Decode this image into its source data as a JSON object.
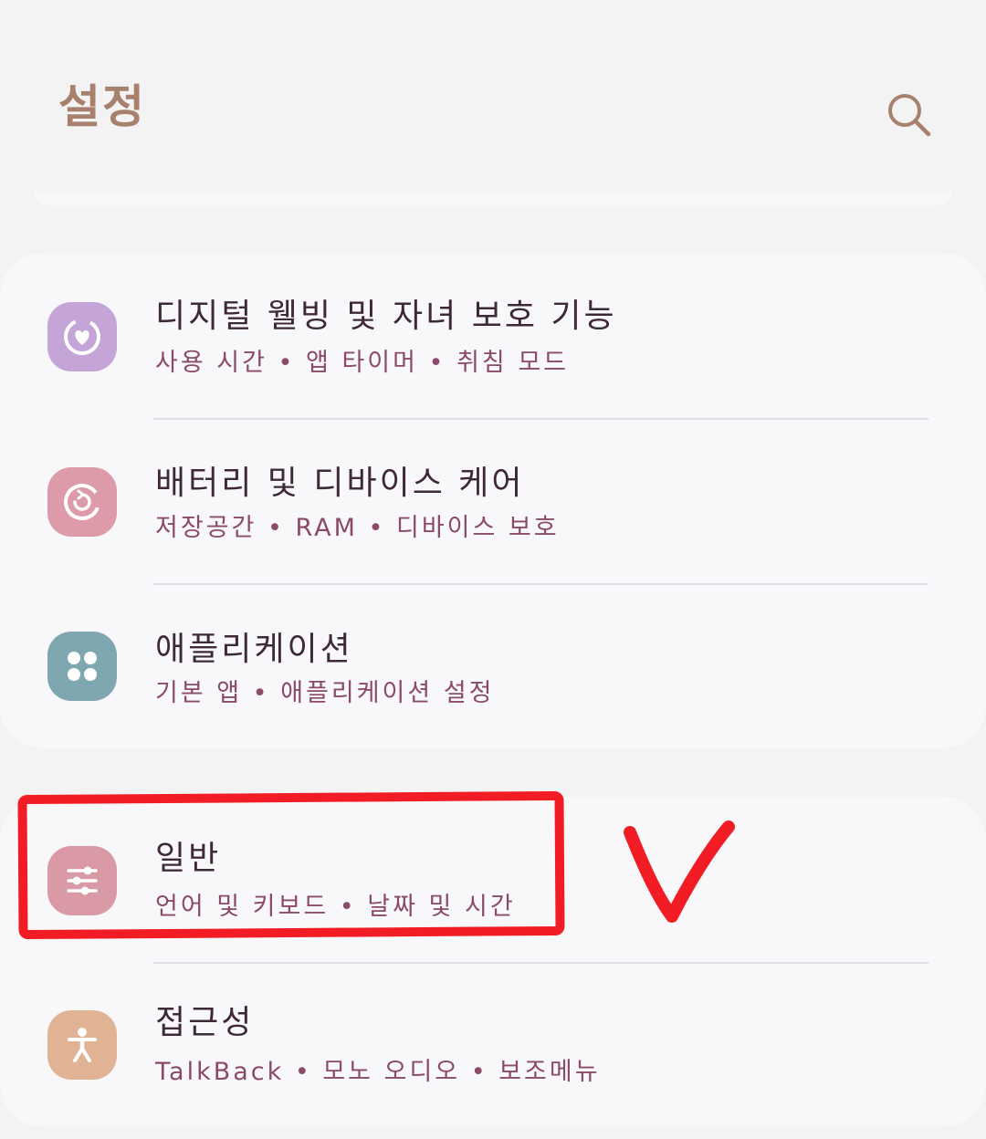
{
  "header": {
    "title": "설정",
    "search_icon": "search-icon"
  },
  "settings": {
    "items": [
      {
        "title": "디지털 웰빙 및 자녀 보호 기능",
        "subtitle": "사용 시간 • 앱 타이머 • 취침 모드",
        "icon": "digital-wellbeing-icon",
        "color": "#c5a5d8"
      },
      {
        "title": "배터리 및 디바이스 케어",
        "subtitle": "저장공간 • RAM • 디바이스 보호",
        "icon": "device-care-icon",
        "color": "#dd9ba9"
      },
      {
        "title": "애플리케이션",
        "subtitle": "기본 앱 • 애플리케이션 설정",
        "icon": "apps-icon",
        "color": "#7fa7b0"
      },
      {
        "title": "일반",
        "subtitle": "언어 및 키보드 • 날짜 및 시간",
        "icon": "general-management-icon",
        "color": "#d99aa6"
      },
      {
        "title": "접근성",
        "subtitle": "TalkBack • 모노 오디오 • 보조메뉴",
        "icon": "accessibility-icon",
        "color": "#dfb394"
      }
    ]
  },
  "annotation": {
    "color": "#f21d24",
    "highlight": "red-rectangle",
    "mark": "red-check-mark"
  }
}
